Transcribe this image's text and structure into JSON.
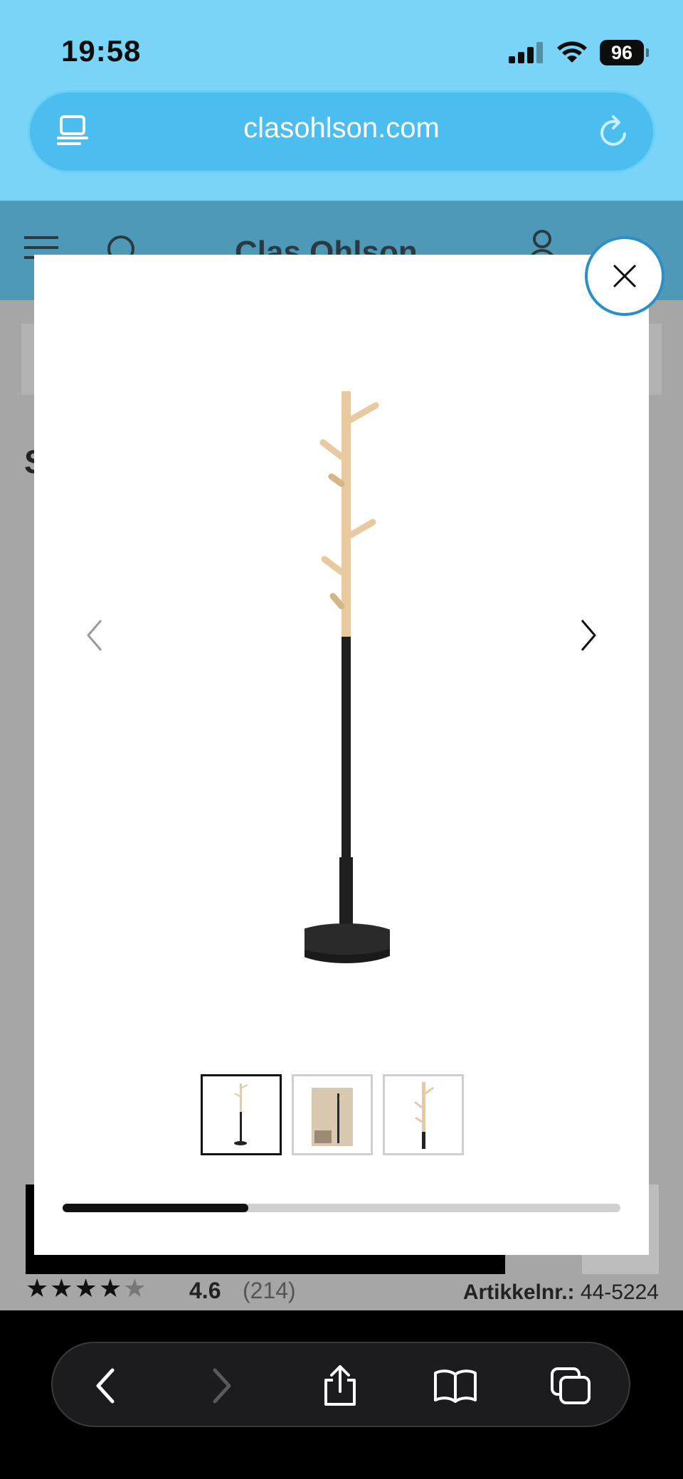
{
  "status": {
    "time": "19:58",
    "battery": "96"
  },
  "browser": {
    "url": "clasohlson.com"
  },
  "site": {
    "logo": "Clas Ohlson",
    "bg_letter": "S"
  },
  "product": {
    "rating": "4.6",
    "review_count": "(214)",
    "article_label": "Artikkelnr.:",
    "article_number": "44-5224",
    "stars_filled": 4.6
  },
  "gallery": {
    "thumbnails": [
      {
        "name": "coat-stand-front",
        "active": true
      },
      {
        "name": "coat-stand-room",
        "active": false
      },
      {
        "name": "coat-stand-detail",
        "active": false
      }
    ],
    "progress": 0.333
  },
  "icons": {
    "tabs": "tabs-icon",
    "reload": "reload-icon",
    "menu": "menu-icon",
    "search": "search-icon",
    "account": "user-icon",
    "close": "close-icon",
    "prev": "chevron-left-icon",
    "next": "chevron-right-icon",
    "back": "back-icon",
    "forward": "forward-icon",
    "share": "share-icon",
    "bookmarks": "book-icon",
    "tab_switcher": "tabs-switcher-icon"
  },
  "colors": {
    "status_bg": "#79d4f8",
    "url_bar": "#4bbdee",
    "header": "#4f99b8",
    "close_border": "#2b8fc7"
  }
}
